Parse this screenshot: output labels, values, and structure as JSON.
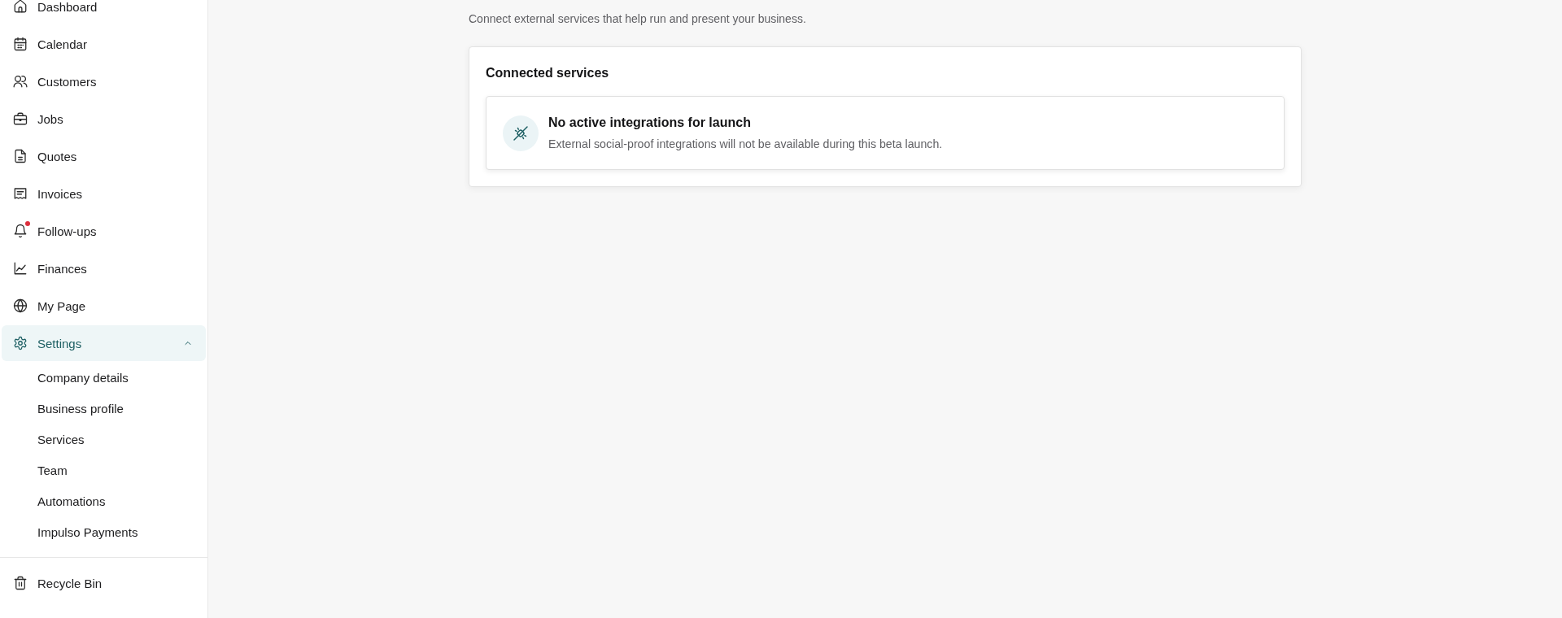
{
  "sidebar": {
    "items": [
      {
        "label": "Dashboard",
        "selected": false,
        "notification": false
      },
      {
        "label": "Calendar",
        "selected": false,
        "notification": false
      },
      {
        "label": "Customers",
        "selected": false,
        "notification": false
      },
      {
        "label": "Jobs",
        "selected": false,
        "notification": false
      },
      {
        "label": "Quotes",
        "selected": false,
        "notification": false
      },
      {
        "label": "Invoices",
        "selected": false,
        "notification": false
      },
      {
        "label": "Follow-ups",
        "selected": false,
        "notification": true
      },
      {
        "label": "Finances",
        "selected": false,
        "notification": false
      },
      {
        "label": "My Page",
        "selected": false,
        "notification": false
      },
      {
        "label": "Settings",
        "selected": true,
        "notification": false,
        "expanded": true,
        "children": [
          {
            "label": "Company details",
            "selected": false
          },
          {
            "label": "Business profile",
            "selected": false
          },
          {
            "label": "Services",
            "selected": false
          },
          {
            "label": "Team",
            "selected": false
          },
          {
            "label": "Automations",
            "selected": false
          },
          {
            "label": "Impulso Payments",
            "selected": false
          }
        ]
      }
    ],
    "bottom_items": [
      {
        "label": "Recycle Bin",
        "selected": false,
        "notification": false
      }
    ]
  },
  "page": {
    "subtitle": "Connect external services that help run and present your business."
  },
  "connected_services": {
    "title": "Connected services",
    "empty_state": {
      "title": "No active integrations for launch",
      "description": "External social-proof integrations will not be available during this beta launch."
    }
  }
}
